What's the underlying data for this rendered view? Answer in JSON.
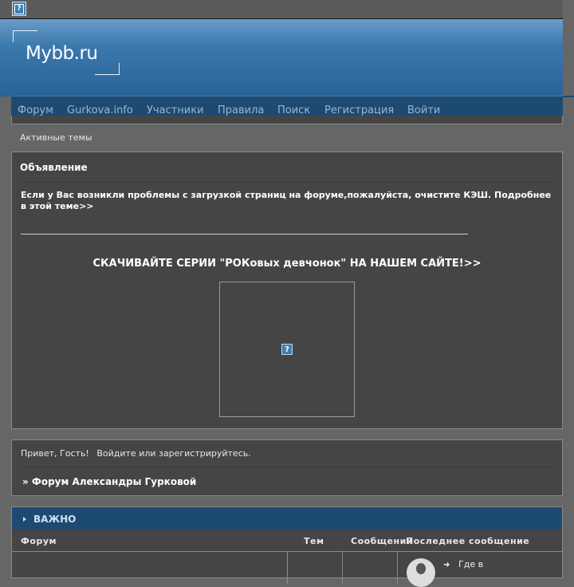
{
  "header": {
    "logo": "Mybb.ru"
  },
  "nav": {
    "items": [
      "Форум",
      "Gurkova.info",
      "Участники",
      "Правила",
      "Поиск",
      "Регистрация",
      "Войти"
    ]
  },
  "active_topics": "Активные темы",
  "announcement": {
    "title": "Объявление",
    "text": "Если у Вас возникли проблемы с загрузкой страниц на форуме,пожалуйста, очистите КЭШ. Подробнее в этой теме>>",
    "link": "СКАЧИВАЙТЕ СЕРИИ \"РОКовых девчонок\" НА НАШЕМ САЙТЕ!>>"
  },
  "welcome": {
    "greeting": "Привет, Гость!",
    "login_prompt": "Войдите или зарегистрируйтесь.",
    "breadcrumb": "» Форум Александры Гурковой"
  },
  "category": {
    "title": "ВАЖНО",
    "columns": {
      "forum": "Форум",
      "topics": "Тем",
      "posts": "Сообщений",
      "last": "Последнее сообщение"
    },
    "rows": [
      {
        "last_post": "Где в"
      }
    ]
  },
  "broken_image_glyph": "?"
}
